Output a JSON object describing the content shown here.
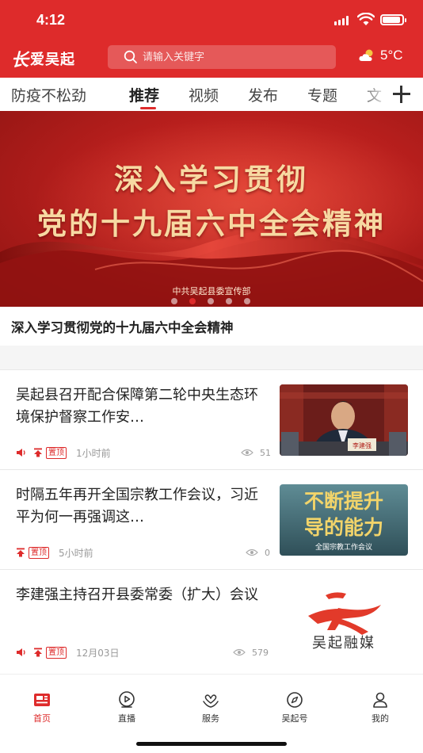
{
  "status_bar": {
    "time": "4:12"
  },
  "header": {
    "logo_mark": "长",
    "logo_text": "爱吴起",
    "search_placeholder": "请输入关键字",
    "weather_icon": "partly-cloudy-icon",
    "temperature": "5°C"
  },
  "tabs": [
    {
      "label": "防疫不松劲"
    },
    {
      "label": "推荐",
      "active": true
    },
    {
      "label": "视频"
    },
    {
      "label": "发布"
    },
    {
      "label": "专题"
    },
    {
      "label": "文"
    }
  ],
  "banner": {
    "line1": "深入学习贯彻",
    "line2": "党的十九届六中全会精神",
    "source": "中共吴起县委宣传部",
    "slide_count": 5,
    "active_slide": 2,
    "caption": "深入学习贯彻党的十九届六中全会精神"
  },
  "news": [
    {
      "title": "吴起县召开配合保障第二轮中央生态环境保护督察工作安…",
      "badge": "置顶",
      "time": "1小时前",
      "views": "51",
      "has_audio": true,
      "thumb_label": "李建强"
    },
    {
      "title": "时隔五年再开全国宗教工作会议，习近平为何一再强调这…",
      "badge": "置顶",
      "time": "5小时前",
      "views": "0",
      "has_audio": false,
      "thumb_line1": "不断提升",
      "thumb_line2": "导的能力",
      "thumb_line3": "全国宗教工作会议"
    },
    {
      "title": "李建强主持召开县委常委（扩大）会议",
      "badge": "置顶",
      "time": "12月03日",
      "views": "579",
      "has_audio": true,
      "thumb_text": "吴起融媒"
    }
  ],
  "bottom_nav": [
    {
      "label": "首页",
      "icon": "news-home-icon",
      "active": true
    },
    {
      "label": "直播",
      "icon": "live-play-icon"
    },
    {
      "label": "服务",
      "icon": "service-heart-icon"
    },
    {
      "label": "吴起号",
      "icon": "compass-icon"
    },
    {
      "label": "我的",
      "icon": "user-icon"
    }
  ],
  "colors": {
    "brand_red": "#de2b2b",
    "banner_gold": "#f7d9a2",
    "meta_gray": "#999999"
  }
}
